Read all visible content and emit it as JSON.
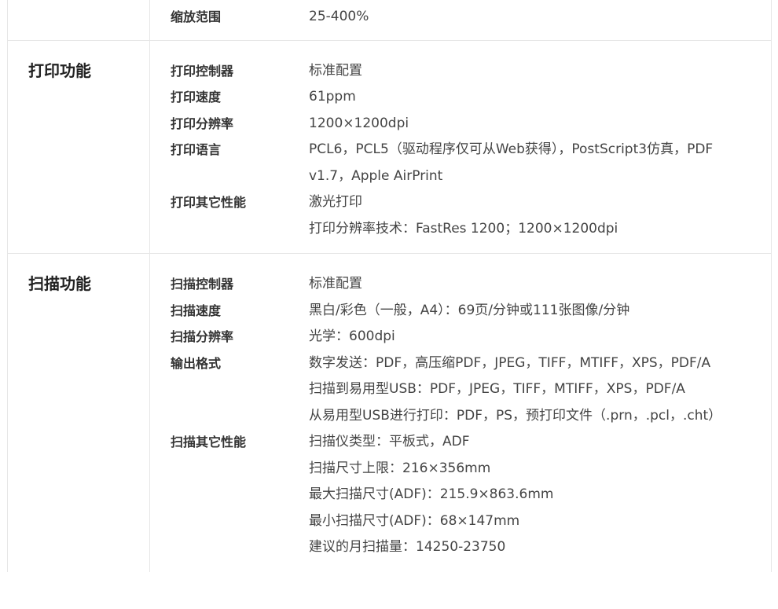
{
  "sections": [
    {
      "category": "",
      "rows": [
        {
          "label": "缩放范围",
          "values": [
            "25-400%"
          ]
        }
      ]
    },
    {
      "category": "打印功能",
      "rows": [
        {
          "label": "打印控制器",
          "values": [
            "标准配置"
          ]
        },
        {
          "label": "打印速度",
          "values": [
            "61ppm"
          ]
        },
        {
          "label": "打印分辨率",
          "values": [
            "1200×1200dpi"
          ]
        },
        {
          "label": "打印语言",
          "values": [
            "PCL6，PCL5（驱动程序仅可从Web获得），PostScript3仿真，PDF",
            "v1.7，Apple AirPrint"
          ]
        },
        {
          "label": "打印其它性能",
          "values": [
            "激光打印",
            "打印分辨率技术：FastRes 1200；1200×1200dpi"
          ]
        }
      ]
    },
    {
      "category": "扫描功能",
      "rows": [
        {
          "label": "扫描控制器",
          "values": [
            "标准配置"
          ]
        },
        {
          "label": "扫描速度",
          "values": [
            "黑白/彩色（一般，A4）：69页/分钟或111张图像/分钟"
          ]
        },
        {
          "label": "扫描分辨率",
          "values": [
            "光学：600dpi"
          ]
        },
        {
          "label": "输出格式",
          "values": [
            "数字发送：PDF，高压缩PDF，JPEG，TIFF，MTIFF，XPS，PDF/A",
            "扫描到易用型USB：PDF，JPEG，TIFF，MTIFF，XPS，PDF/A",
            "从易用型USB进行打印：PDF，PS，预打印文件（.prn，.pcl，.cht）"
          ]
        },
        {
          "label": "扫描其它性能",
          "values": [
            "扫描仪类型：平板式，ADF",
            "扫描尺寸上限：216×356mm",
            "最大扫描尺寸(ADF)：215.9×863.6mm",
            "最小扫描尺寸(ADF)：68×147mm",
            "建议的月扫描量：14250-23750"
          ]
        }
      ]
    }
  ]
}
